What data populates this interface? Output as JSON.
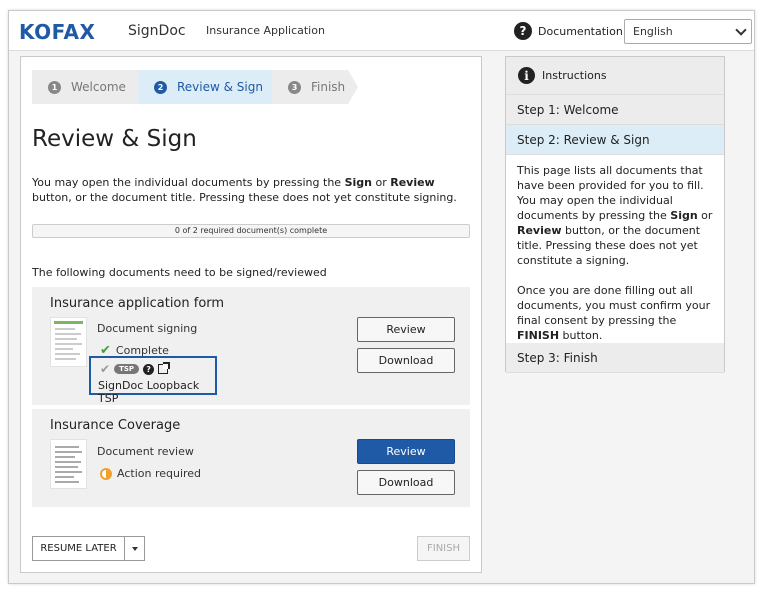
{
  "header": {
    "logo": "KOFAX",
    "product": "SignDoc",
    "app_title": "Insurance Application",
    "documentation_label": "Documentation",
    "language": "English"
  },
  "steps": [
    {
      "num": "1",
      "label": "Welcome"
    },
    {
      "num": "2",
      "label": "Review & Sign"
    },
    {
      "num": "3",
      "label": "Finish"
    }
  ],
  "main": {
    "title": "Review & Sign",
    "intro_a": "You may open the individual documents by pressing the ",
    "intro_sign": "Sign",
    "intro_or": " or ",
    "intro_review": "Review",
    "intro_b": " button, or the document title. Pressing these does not yet constitute signing.",
    "progress_text": "0 of 2 required document(s) complete",
    "progress_fraction": 0,
    "list_heading": "The following documents need to be signed/reviewed"
  },
  "documents": [
    {
      "title": "Insurance application form",
      "type": "Document signing",
      "status": "Complete",
      "tsp_badge": "TSP",
      "tsp_name": "SignDoc Loopback TSP",
      "review_label": "Review",
      "download_label": "Download"
    },
    {
      "title": "Insurance Coverage",
      "type": "Document review",
      "status": "Action required",
      "review_label": "Review",
      "download_label": "Download"
    }
  ],
  "footer": {
    "resume_label": "RESUME LATER",
    "finish_label": "FINISH"
  },
  "instructions": {
    "heading": "Instructions",
    "step1": "Step 1: Welcome",
    "step2": "Step 2: Review & Sign",
    "step3": "Step 3: Finish",
    "p1_a": "This page lists all documents that have been provided for you to fill. You may open the individual documents by pressing the ",
    "p1_sign": "Sign",
    "p1_or": " or ",
    "p1_review": "Review",
    "p1_b": " button, or the document title. Pressing these does not yet constitute a signing.",
    "p2_a": "Once you are done filling out all documents, you must confirm your final consent by pressing the ",
    "p2_finish": "FINISH",
    "p2_b": " button."
  },
  "colors": {
    "brand_blue": "#1f5aa6",
    "active_step_bg": "#dcedf8",
    "complete_green": "#3ba53b",
    "pending_orange": "#f0a030"
  }
}
